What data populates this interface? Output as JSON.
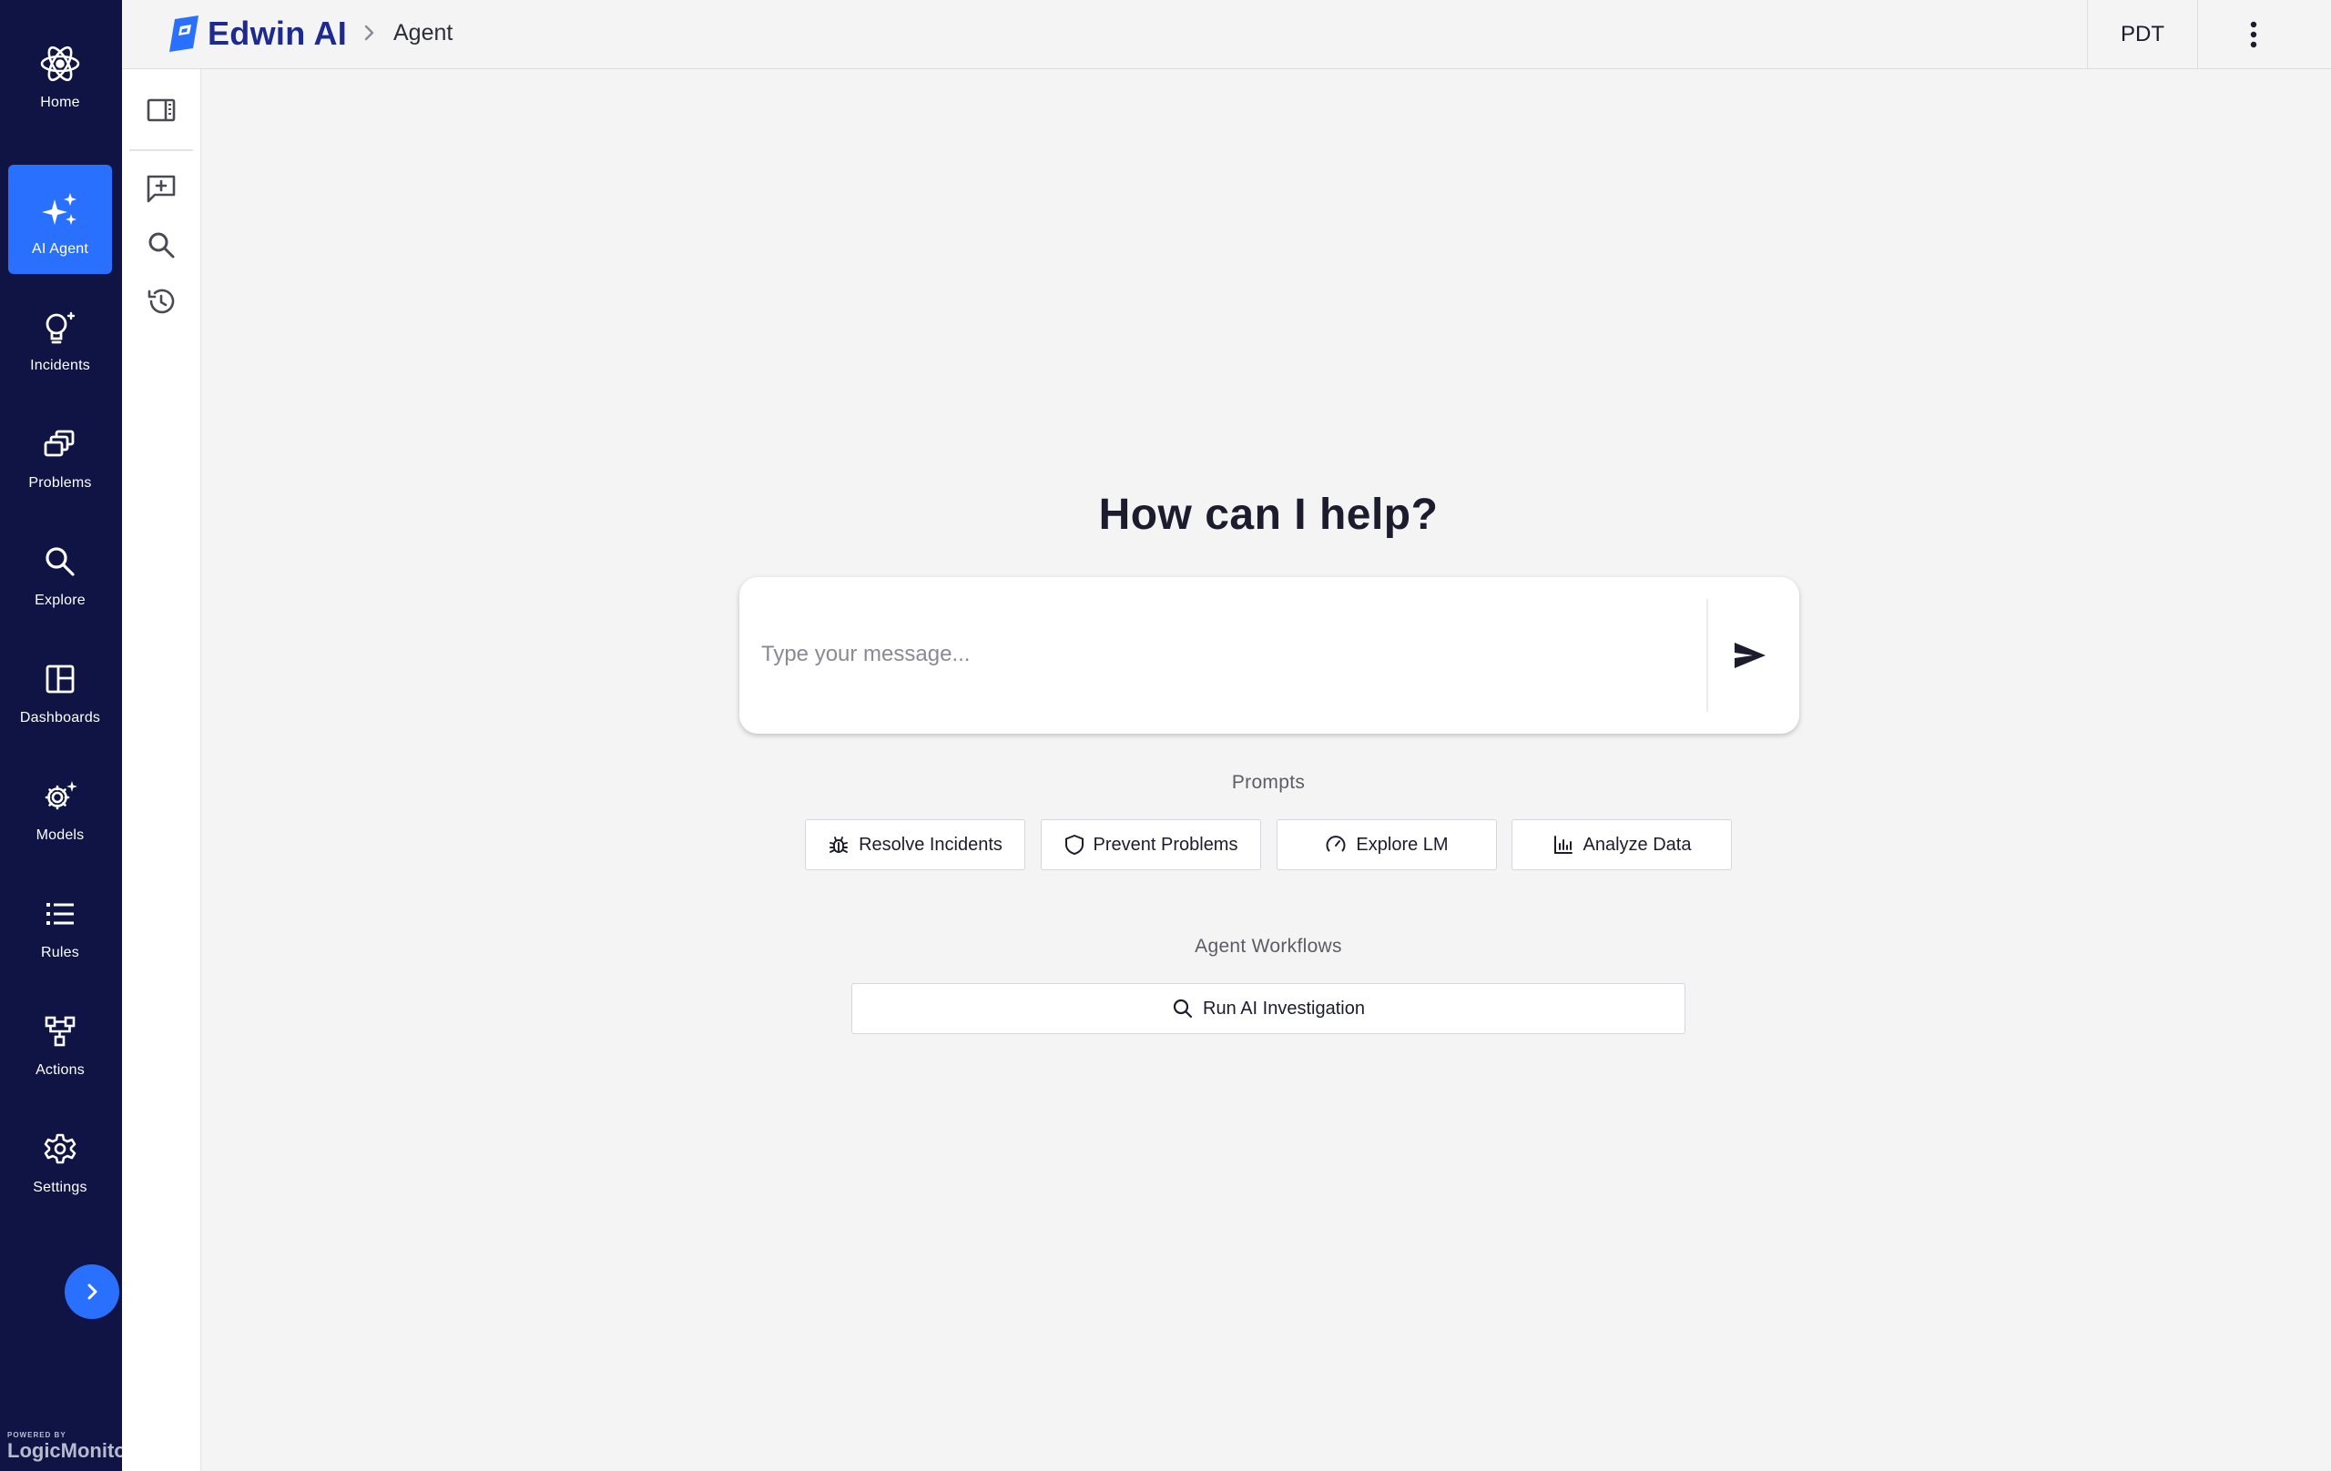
{
  "nav": {
    "items": [
      {
        "label": "Home",
        "icon": "atom-icon",
        "active": false
      },
      {
        "label": "AI Agent",
        "icon": "sparkles-icon",
        "active": true
      },
      {
        "label": "Incidents",
        "icon": "lightbulb-icon",
        "active": false
      },
      {
        "label": "Problems",
        "icon": "stacked-windows-icon",
        "active": false
      },
      {
        "label": "Explore",
        "icon": "search-icon",
        "active": false
      },
      {
        "label": "Dashboards",
        "icon": "dashboard-grid-icon",
        "active": false
      },
      {
        "label": "Models",
        "icon": "gear-sparkle-icon",
        "active": false
      },
      {
        "label": "Rules",
        "icon": "list-icon",
        "active": false
      },
      {
        "label": "Actions",
        "icon": "workflow-icon",
        "active": false
      },
      {
        "label": "Settings",
        "icon": "gear-icon",
        "active": false
      }
    ],
    "expand_icon": "chevron-right-icon",
    "powered_by": {
      "small": "POWERED BY",
      "brand": "LogicMonitor"
    }
  },
  "tools": [
    {
      "name": "toggle-panel-icon"
    },
    {
      "name": "new-chat-icon"
    },
    {
      "name": "search-icon"
    },
    {
      "name": "history-icon"
    }
  ],
  "header": {
    "brand": "Edwin AI",
    "breadcrumb": "Agent",
    "timezone": "PDT",
    "more_icon": "kebab-menu-icon"
  },
  "main": {
    "headline": "How can I help?",
    "input_placeholder": "Type your message...",
    "prompts_label": "Prompts",
    "prompts": [
      {
        "label": "Resolve Incidents",
        "icon": "bug-icon"
      },
      {
        "label": "Prevent Problems",
        "icon": "shield-icon"
      },
      {
        "label": "Explore LM",
        "icon": "gauge-icon"
      },
      {
        "label": "Analyze Data",
        "icon": "bar-chart-icon"
      }
    ],
    "workflows_label": "Agent Workflows",
    "workflow": {
      "label": "Run AI Investigation",
      "icon": "search-icon"
    }
  },
  "colors": {
    "nav_bg": "#0f1444",
    "accent": "#2970ff",
    "brand": "#1d2a8f",
    "page_bg": "#f4f4f4"
  }
}
